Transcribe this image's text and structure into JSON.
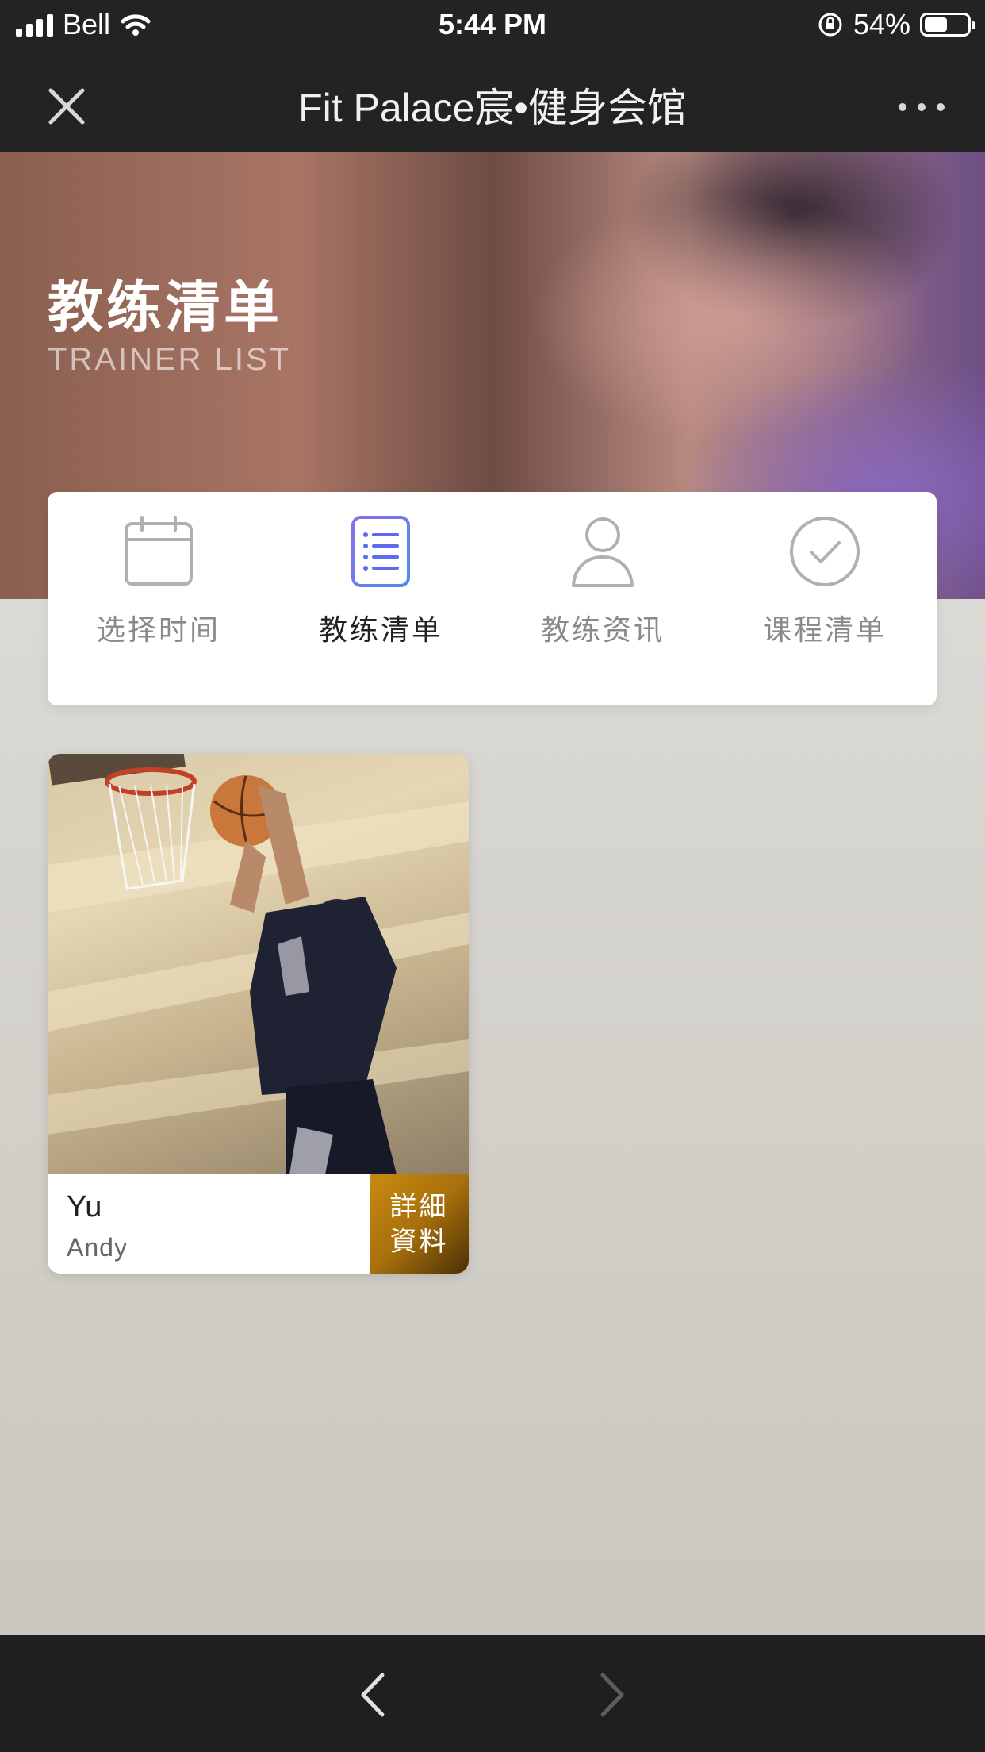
{
  "status_bar": {
    "carrier": "Bell",
    "time": "5:44 PM",
    "battery_percent": "54%",
    "battery_level": 0.54
  },
  "nav_bar": {
    "title": "Fit Palace宸•健身会馆",
    "close_icon": "close-icon",
    "more_icon": "more-icon"
  },
  "hero": {
    "title": "教练清单",
    "subtitle": "TRAINER LIST"
  },
  "tabs": [
    {
      "label": "选择时间",
      "icon": "calendar-icon",
      "active": false
    },
    {
      "label": "教练清单",
      "icon": "list-icon",
      "active": true
    },
    {
      "label": "教练资讯",
      "icon": "person-icon",
      "active": false
    },
    {
      "label": "课程清单",
      "icon": "check-circle-icon",
      "active": false
    }
  ],
  "trainers": [
    {
      "last_name": "Yu",
      "first_name": "Andy",
      "detail_label_line1": "詳細",
      "detail_label_line2": "資料"
    }
  ],
  "colors": {
    "accent_blue": "#5b6cf0",
    "accent_purple": "#8a6ee8",
    "detail_button": "#b47a10",
    "bar_dark": "#232323"
  },
  "bottom_bar": {
    "back_icon": "chevron-left-icon",
    "forward_icon": "chevron-right-icon"
  }
}
